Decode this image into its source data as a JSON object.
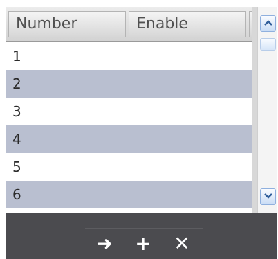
{
  "grid": {
    "columns": [
      "Number",
      "Enable"
    ],
    "rows": [
      {
        "number": "1",
        "enable": ""
      },
      {
        "number": "2",
        "enable": ""
      },
      {
        "number": "3",
        "enable": ""
      },
      {
        "number": "4",
        "enable": ""
      },
      {
        "number": "5",
        "enable": ""
      },
      {
        "number": "6",
        "enable": ""
      }
    ]
  },
  "scrollbar": {
    "up_icon": "chevron-up-icon",
    "down_icon": "chevron-down-icon"
  },
  "toolbar": {
    "buttons": [
      {
        "icon": "arrow-right-icon",
        "glyph": "➜"
      },
      {
        "icon": "plus-icon",
        "glyph": "+"
      },
      {
        "icon": "close-icon",
        "glyph": "✕"
      }
    ]
  },
  "colors": {
    "row_alt": "#b9bfd0",
    "toolbar_bg": "#4b4b4f",
    "scroll_accent": "#2f5d9a"
  }
}
